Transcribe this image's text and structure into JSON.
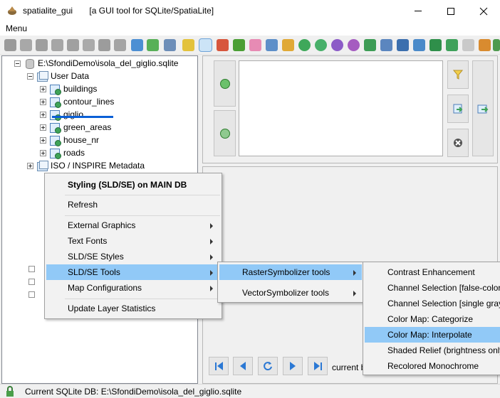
{
  "window": {
    "title": "spatialite_gui       [a GUI tool for SQLite/SpatiaLite]"
  },
  "menubar": {
    "menu_label": "Menu"
  },
  "tree": {
    "root": "E:\\SfondiDemo\\isola_del_giglio.sqlite",
    "user_data": "User Data",
    "tables": [
      "buildings",
      "contour_lines",
      "giglio",
      "green_areas",
      "house_nr",
      "roads"
    ],
    "metadata": "ISO / INSPIRE Metadata"
  },
  "context_menu": {
    "header": "Styling (SLD/SE) on MAIN DB",
    "refresh": "Refresh",
    "external_graphics": "External Graphics",
    "text_fonts": "Text Fonts",
    "sld_styles": "SLD/SE Styles",
    "sld_tools": "SLD/SE Tools",
    "map_configurations": "Map Configurations",
    "update_stats": "Update Layer Statistics"
  },
  "submenu_tools": {
    "raster": "RasterSymbolizer tools",
    "vector": "VectorSymbolizer tools"
  },
  "submenu_raster": {
    "items": [
      "Contrast Enhancement",
      "Channel Selection [false-color",
      "Channel Selection [single gray",
      "Color Map: Categorize",
      "Color Map: Interpolate",
      "Shaded Relief (brightness only",
      "Recolored Monochrome"
    ]
  },
  "results": {
    "current_label": "current b"
  },
  "status": {
    "text": "Current SQLite DB: E:\\SfondiDemo\\isola_del_giglio.sqlite"
  }
}
